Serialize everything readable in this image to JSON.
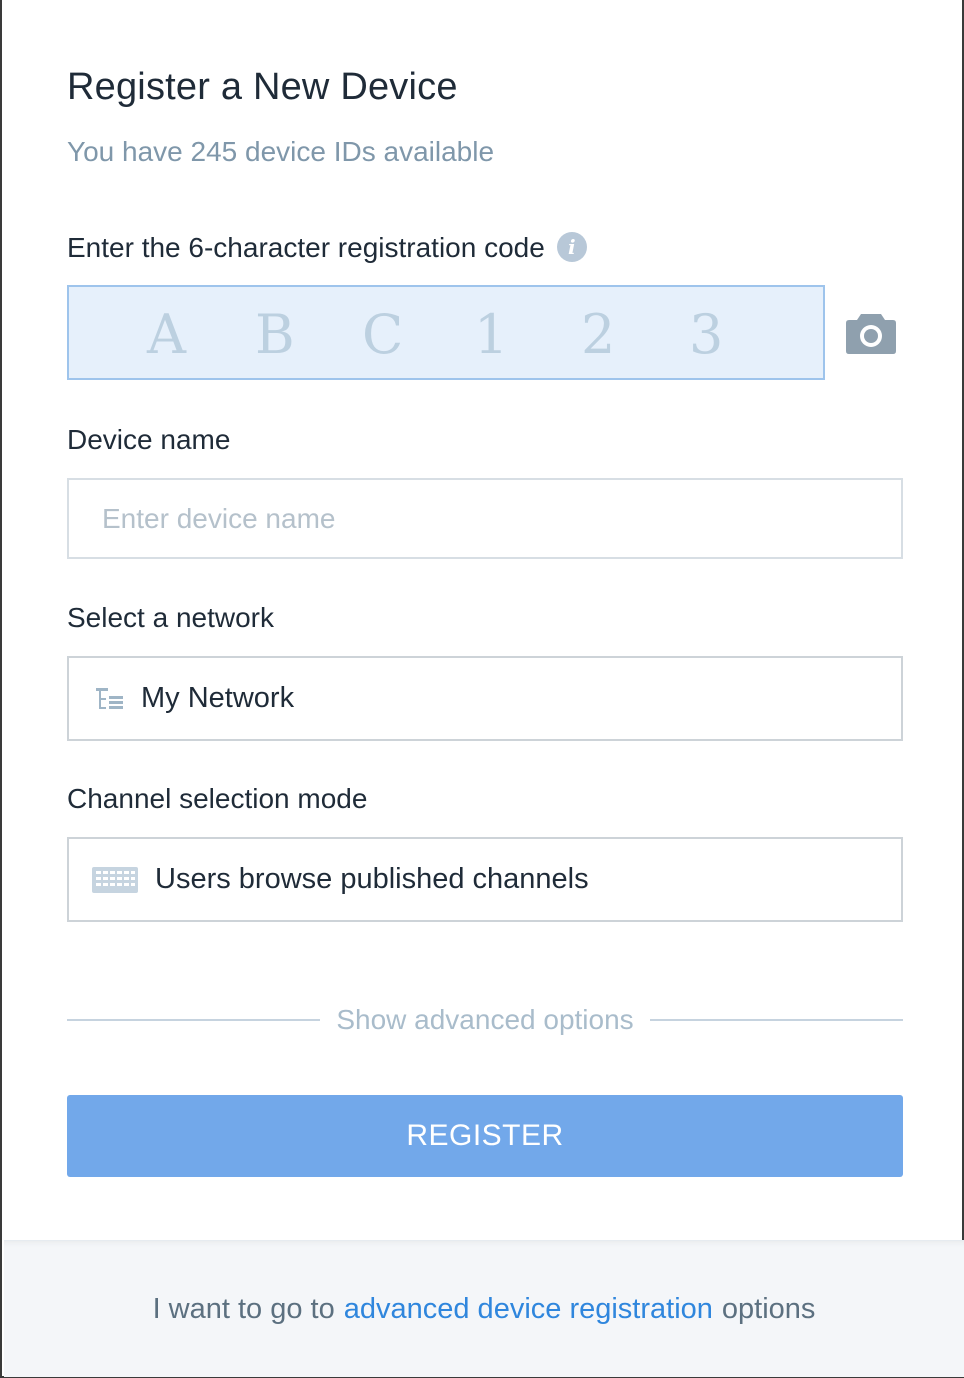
{
  "header": {
    "title": "Register a New Device",
    "subtitle": "You have 245 device IDs available"
  },
  "registration_code": {
    "label": "Enter the 6-character registration code",
    "info_icon": "info-icon",
    "placeholder_chars": [
      "A",
      "B",
      "C",
      "1",
      "2",
      "3"
    ],
    "camera_icon": "camera-icon"
  },
  "device_name": {
    "label": "Device name",
    "placeholder": "Enter device name",
    "value": ""
  },
  "network": {
    "label": "Select a network",
    "icon": "network-tree-icon",
    "value": "My Network"
  },
  "channel_mode": {
    "label": "Channel selection mode",
    "icon": "keyboard-grid-icon",
    "value": "Users browse published channels"
  },
  "advanced_toggle": {
    "label": "Show advanced options"
  },
  "register_button": {
    "label": "REGISTER",
    "color": "#72a8ea"
  },
  "footer": {
    "prefix": "I want to go to",
    "link": "advanced device registration",
    "suffix": "options"
  },
  "colors": {
    "text": "#1f2b38",
    "muted": "#7f97aa",
    "code_box_bg": "#e6f0fb",
    "link": "#2f86dd"
  }
}
